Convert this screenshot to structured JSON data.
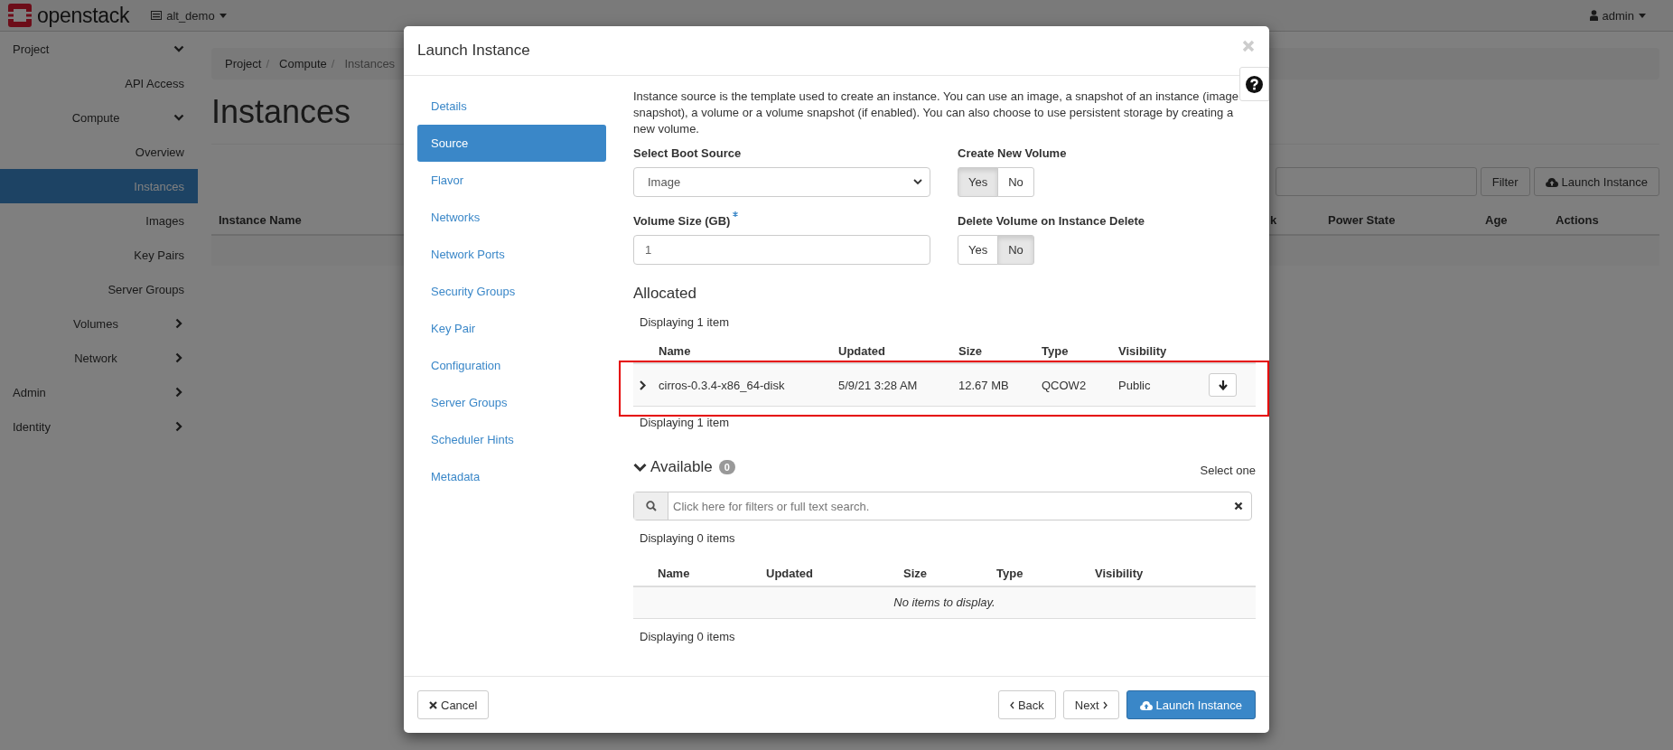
{
  "topbar": {
    "logo": "openstack",
    "project": "alt_demo",
    "user": "admin"
  },
  "sidebar": {
    "items": [
      {
        "label": "Project",
        "kind": "group",
        "expanded": true,
        "children": [
          {
            "label": "API Access",
            "kind": "link",
            "selected": false
          },
          {
            "label": "Compute",
            "kind": "group",
            "expanded": true,
            "children": [
              {
                "label": "Overview",
                "kind": "link",
                "selected": false
              },
              {
                "label": "Instances",
                "kind": "link",
                "selected": true
              },
              {
                "label": "Images",
                "kind": "link",
                "selected": false
              },
              {
                "label": "Key Pairs",
                "kind": "link",
                "selected": false
              },
              {
                "label": "Server Groups",
                "kind": "link",
                "selected": false
              }
            ]
          },
          {
            "label": "Volumes",
            "kind": "group",
            "expanded": false
          },
          {
            "label": "Network",
            "kind": "group",
            "expanded": false
          }
        ]
      },
      {
        "label": "Admin",
        "kind": "group",
        "expanded": false
      },
      {
        "label": "Identity",
        "kind": "group",
        "expanded": false
      }
    ]
  },
  "breadcrumb": [
    {
      "label": "Project",
      "separator": "/"
    },
    {
      "label": "Compute",
      "separator": "/"
    },
    {
      "label": "Instances"
    }
  ],
  "page_title": "Instances",
  "toolbar": {
    "filter_button": "Filter",
    "launch_button": "Launch Instance"
  },
  "instances_table": {
    "columns": [
      "Instance Name",
      "k",
      "Power State",
      "Age",
      "Actions"
    ]
  },
  "modal": {
    "title": "Launch Instance",
    "steps": [
      {
        "label": "Details",
        "selected": false
      },
      {
        "label": "Source",
        "selected": true
      },
      {
        "label": "Flavor",
        "selected": false
      },
      {
        "label": "Networks",
        "selected": false
      },
      {
        "label": "Network Ports",
        "selected": false
      },
      {
        "label": "Security Groups",
        "selected": false
      },
      {
        "label": "Key Pair",
        "selected": false
      },
      {
        "label": "Configuration",
        "selected": false
      },
      {
        "label": "Server Groups",
        "selected": false
      },
      {
        "label": "Scheduler Hints",
        "selected": false
      },
      {
        "label": "Metadata",
        "selected": false
      }
    ],
    "description": "Instance source is the template used to create an instance. You can use an image, a snapshot of an instance (image snapshot), a volume or a volume snapshot (if enabled). You can also choose to use persistent storage by creating a new volume.",
    "boot_source": {
      "label": "Select Boot Source",
      "value": "Image"
    },
    "create_volume": {
      "label": "Create New Volume",
      "options": [
        {
          "label": "Yes",
          "selected": true
        },
        {
          "label": "No",
          "selected": false
        }
      ]
    },
    "volume_size": {
      "label": "Volume Size (GB)",
      "required": true,
      "value": "1"
    },
    "delete_volume": {
      "label": "Delete Volume on Instance Delete",
      "options": [
        {
          "label": "Yes",
          "selected": false
        },
        {
          "label": "No",
          "selected": true
        }
      ]
    },
    "allocated": {
      "title": "Allocated",
      "count_top": "Displaying 1 item",
      "columns": [
        "Name",
        "Updated",
        "Size",
        "Type",
        "Visibility"
      ],
      "rows": [
        {
          "name": "cirros-0.3.4-x86_64-disk",
          "updated": "5/9/21 3:28 AM",
          "size": "12.67 MB",
          "type": "QCOW2",
          "visibility": "Public",
          "highlighted": true
        }
      ],
      "count_bottom": "Displaying 1 item"
    },
    "available": {
      "title": "Available",
      "expanded": true,
      "badge": "0",
      "select_hint": "Select one",
      "search": {
        "placeholder": "Click here for filters or full text search."
      },
      "count_top": "Displaying 0 items",
      "columns": [
        "Name",
        "Updated",
        "Size",
        "Type",
        "Visibility"
      ],
      "empty_message": "No items to display.",
      "count_bottom": "Displaying 0 items"
    },
    "footer": {
      "cancel": "Cancel",
      "back": "Back",
      "next": "Next",
      "launch": "Launch Instance"
    }
  }
}
